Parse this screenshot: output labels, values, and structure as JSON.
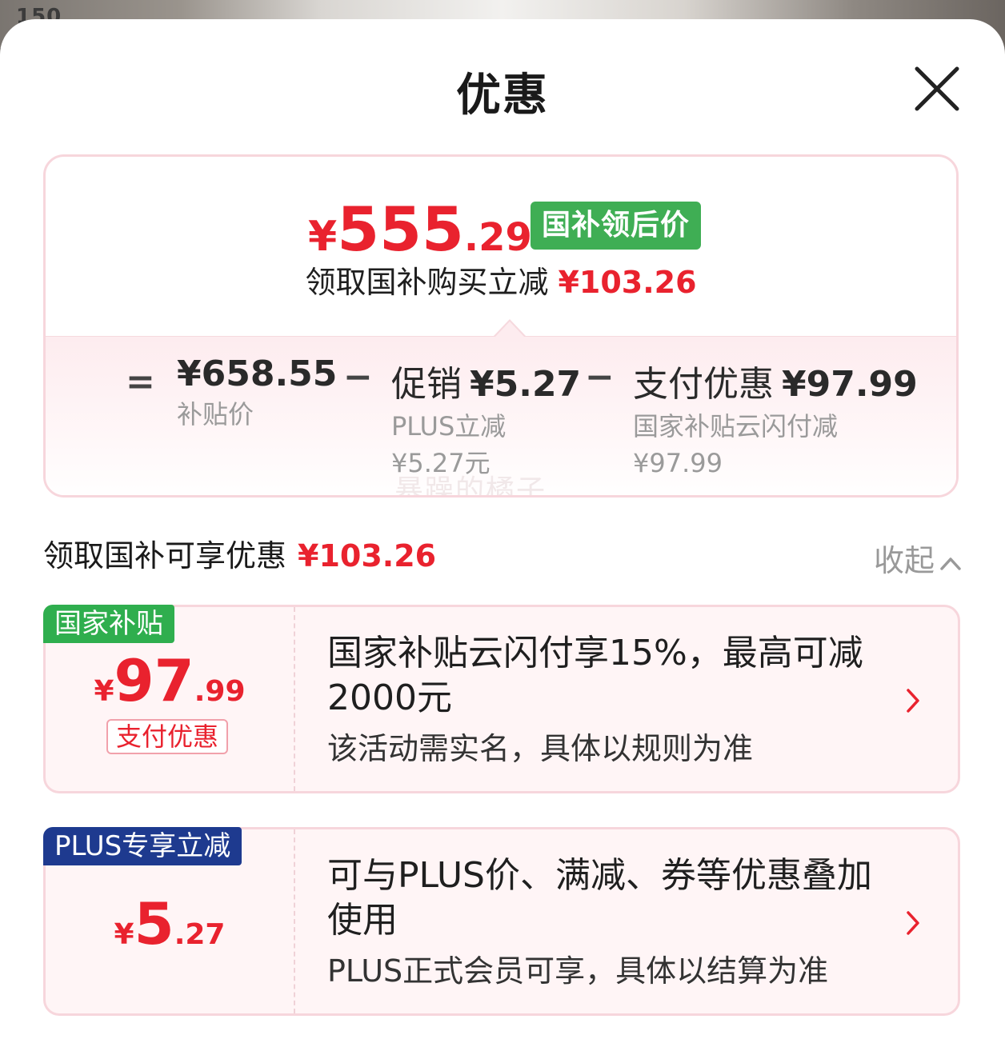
{
  "background": {
    "partial_text": "150"
  },
  "header": {
    "title": "优惠"
  },
  "summary": {
    "currency": "¥",
    "price_int": "555",
    "price_dec": ".29",
    "badge": "国补领后价",
    "subline_text": "领取国补购买立减",
    "subline_amount": "¥103.26",
    "equals": "=",
    "minus": "−",
    "items": [
      {
        "value": "¥658.55",
        "label": "补贴价"
      },
      {
        "title": "促销",
        "value": "¥5.27",
        "line1": "PLUS立减",
        "line2": "¥5.27元"
      },
      {
        "title": "支付优惠",
        "value": "¥97.99",
        "line1": "国家补贴云闪付减",
        "line2": "¥97.99"
      }
    ],
    "watermark": "暴躁的橘子"
  },
  "section": {
    "title": "领取国补可享优惠",
    "amount": "¥103.26",
    "collapse_label": "收起"
  },
  "offers": [
    {
      "tag": "国家补贴",
      "tag_color": "#2fae4e",
      "currency": "¥",
      "amount_int": "97",
      "amount_dec": ".99",
      "pill": "支付优惠",
      "desc": "国家补贴云闪付享15%，最高可减2000元",
      "note": "该活动需实名，具体以规则为准"
    },
    {
      "tag": "PLUS专享立减",
      "tag_color": "#1e3a8f",
      "currency": "¥",
      "amount_int": "5",
      "amount_dec": ".27",
      "desc": "可与PLUS价、满减、券等优惠叠加使用",
      "note": "PLUS正式会员可享，具体以结算为准"
    }
  ],
  "colors": {
    "accent_red": "#e9222e",
    "badge_green": "#3fae54",
    "card_bg": "#fff5f6",
    "card_border": "#f7d6dc"
  }
}
